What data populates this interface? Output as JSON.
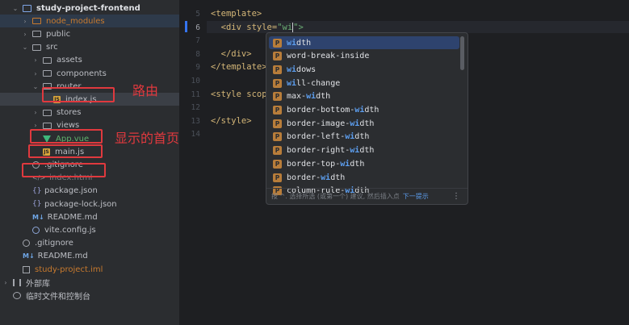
{
  "tree": {
    "rows": [
      {
        "label": "study-project-frontend",
        "icon": "module-icon",
        "chev": "⌄",
        "indent": 14
      },
      {
        "label": "node_modules",
        "icon": "folder-excluded-icon",
        "chev": "›",
        "indent": 26,
        "style": "orange"
      },
      {
        "label": "public",
        "icon": "folder-icon",
        "chev": "›",
        "indent": 26
      },
      {
        "label": "src",
        "icon": "folder-icon",
        "chev": "⌄",
        "indent": 26
      },
      {
        "label": "assets",
        "icon": "folder-icon",
        "chev": "›",
        "indent": 39
      },
      {
        "label": "components",
        "icon": "folder-icon",
        "chev": "›",
        "indent": 39
      },
      {
        "label": "router",
        "icon": "folder-icon",
        "chev": "⌄",
        "indent": 39
      },
      {
        "label": "index.js",
        "icon": "js-icon",
        "chev": "",
        "indent": 52
      },
      {
        "label": "stores",
        "icon": "folder-icon",
        "chev": "›",
        "indent": 39
      },
      {
        "label": "views",
        "icon": "folder-icon",
        "chev": "›",
        "indent": 39
      },
      {
        "label": "App.vue",
        "icon": "vue-icon",
        "chev": "",
        "indent": 39,
        "style": "green"
      },
      {
        "label": "main.js",
        "icon": "js-icon",
        "chev": "",
        "indent": 39
      },
      {
        "label": ".gitignore",
        "icon": "git-icon",
        "chev": "",
        "indent": 26
      },
      {
        "label": "index.html",
        "icon": "html-icon",
        "chev": "",
        "indent": 26,
        "style": "dim"
      },
      {
        "label": "package.json",
        "icon": "json-icon",
        "chev": "",
        "indent": 26
      },
      {
        "label": "package-lock.json",
        "icon": "json-icon",
        "chev": "",
        "indent": 26
      },
      {
        "label": "README.md",
        "icon": "md-icon",
        "chev": "",
        "indent": 26
      },
      {
        "label": "vite.config.js",
        "icon": "vite-icon",
        "chev": "",
        "indent": 26
      },
      {
        "label": ".gitignore",
        "icon": "git-icon",
        "chev": "",
        "indent": 14
      },
      {
        "label": "README.md",
        "icon": "md-icon",
        "chev": "",
        "indent": 14
      },
      {
        "label": "study-project.iml",
        "icon": "iml-icon",
        "chev": "",
        "indent": 14,
        "style": "orange"
      },
      {
        "label": "外部库",
        "icon": "library-icon",
        "chev": "›",
        "indent": 2
      },
      {
        "label": "临时文件和控制台",
        "icon": "scratch-icon",
        "chev": "",
        "indent": 2
      }
    ],
    "annotations": {
      "router_note": "路由",
      "homepage_note": "显示的首页"
    }
  },
  "editor": {
    "line_numbers": [
      "5",
      "6",
      "7",
      "8",
      "9",
      "10",
      "11",
      "12",
      "13",
      "14"
    ],
    "current_line": "6",
    "lines": [
      {
        "text": "<template>"
      },
      {
        "before": "  <div style=",
        "string": "\"wi",
        "after": "\">"
      },
      {
        "text": ""
      },
      {
        "text": "  </div>"
      },
      {
        "text": "</template>"
      },
      {
        "text": ""
      },
      {
        "text": "<style scop"
      },
      {
        "text": ""
      },
      {
        "text": "</style>"
      },
      {
        "text": ""
      }
    ]
  },
  "completion": {
    "items": [
      {
        "match": "wi",
        "rest": "dth",
        "prefix": ""
      },
      {
        "prefix": "word-break-inside",
        "match": "",
        "rest": ""
      },
      {
        "match": "wi",
        "rest": "dows",
        "prefix": ""
      },
      {
        "prefix": "",
        "match": "wi",
        "rest": "ll-change"
      },
      {
        "prefix": "max-",
        "match": "wi",
        "rest": "dth"
      },
      {
        "prefix": "border-bottom-",
        "match": "wi",
        "rest": "dth"
      },
      {
        "prefix": "border-image-",
        "match": "wi",
        "rest": "dth"
      },
      {
        "prefix": "border-left-",
        "match": "wi",
        "rest": "dth"
      },
      {
        "prefix": "border-right-",
        "match": "wi",
        "rest": "dth"
      },
      {
        "prefix": "border-top-",
        "match": "wi",
        "rest": "dth"
      },
      {
        "prefix": "border-",
        "match": "wi",
        "rest": "dth"
      },
      {
        "prefix": "column-rule-",
        "match": "wi",
        "rest": "dth"
      }
    ],
    "item_badge": "P",
    "footer_hint": "按 ^. 选择所选 (或第一个) 建议, 然后插入点",
    "footer_link": "下一提示",
    "footer_more": "⋮"
  }
}
